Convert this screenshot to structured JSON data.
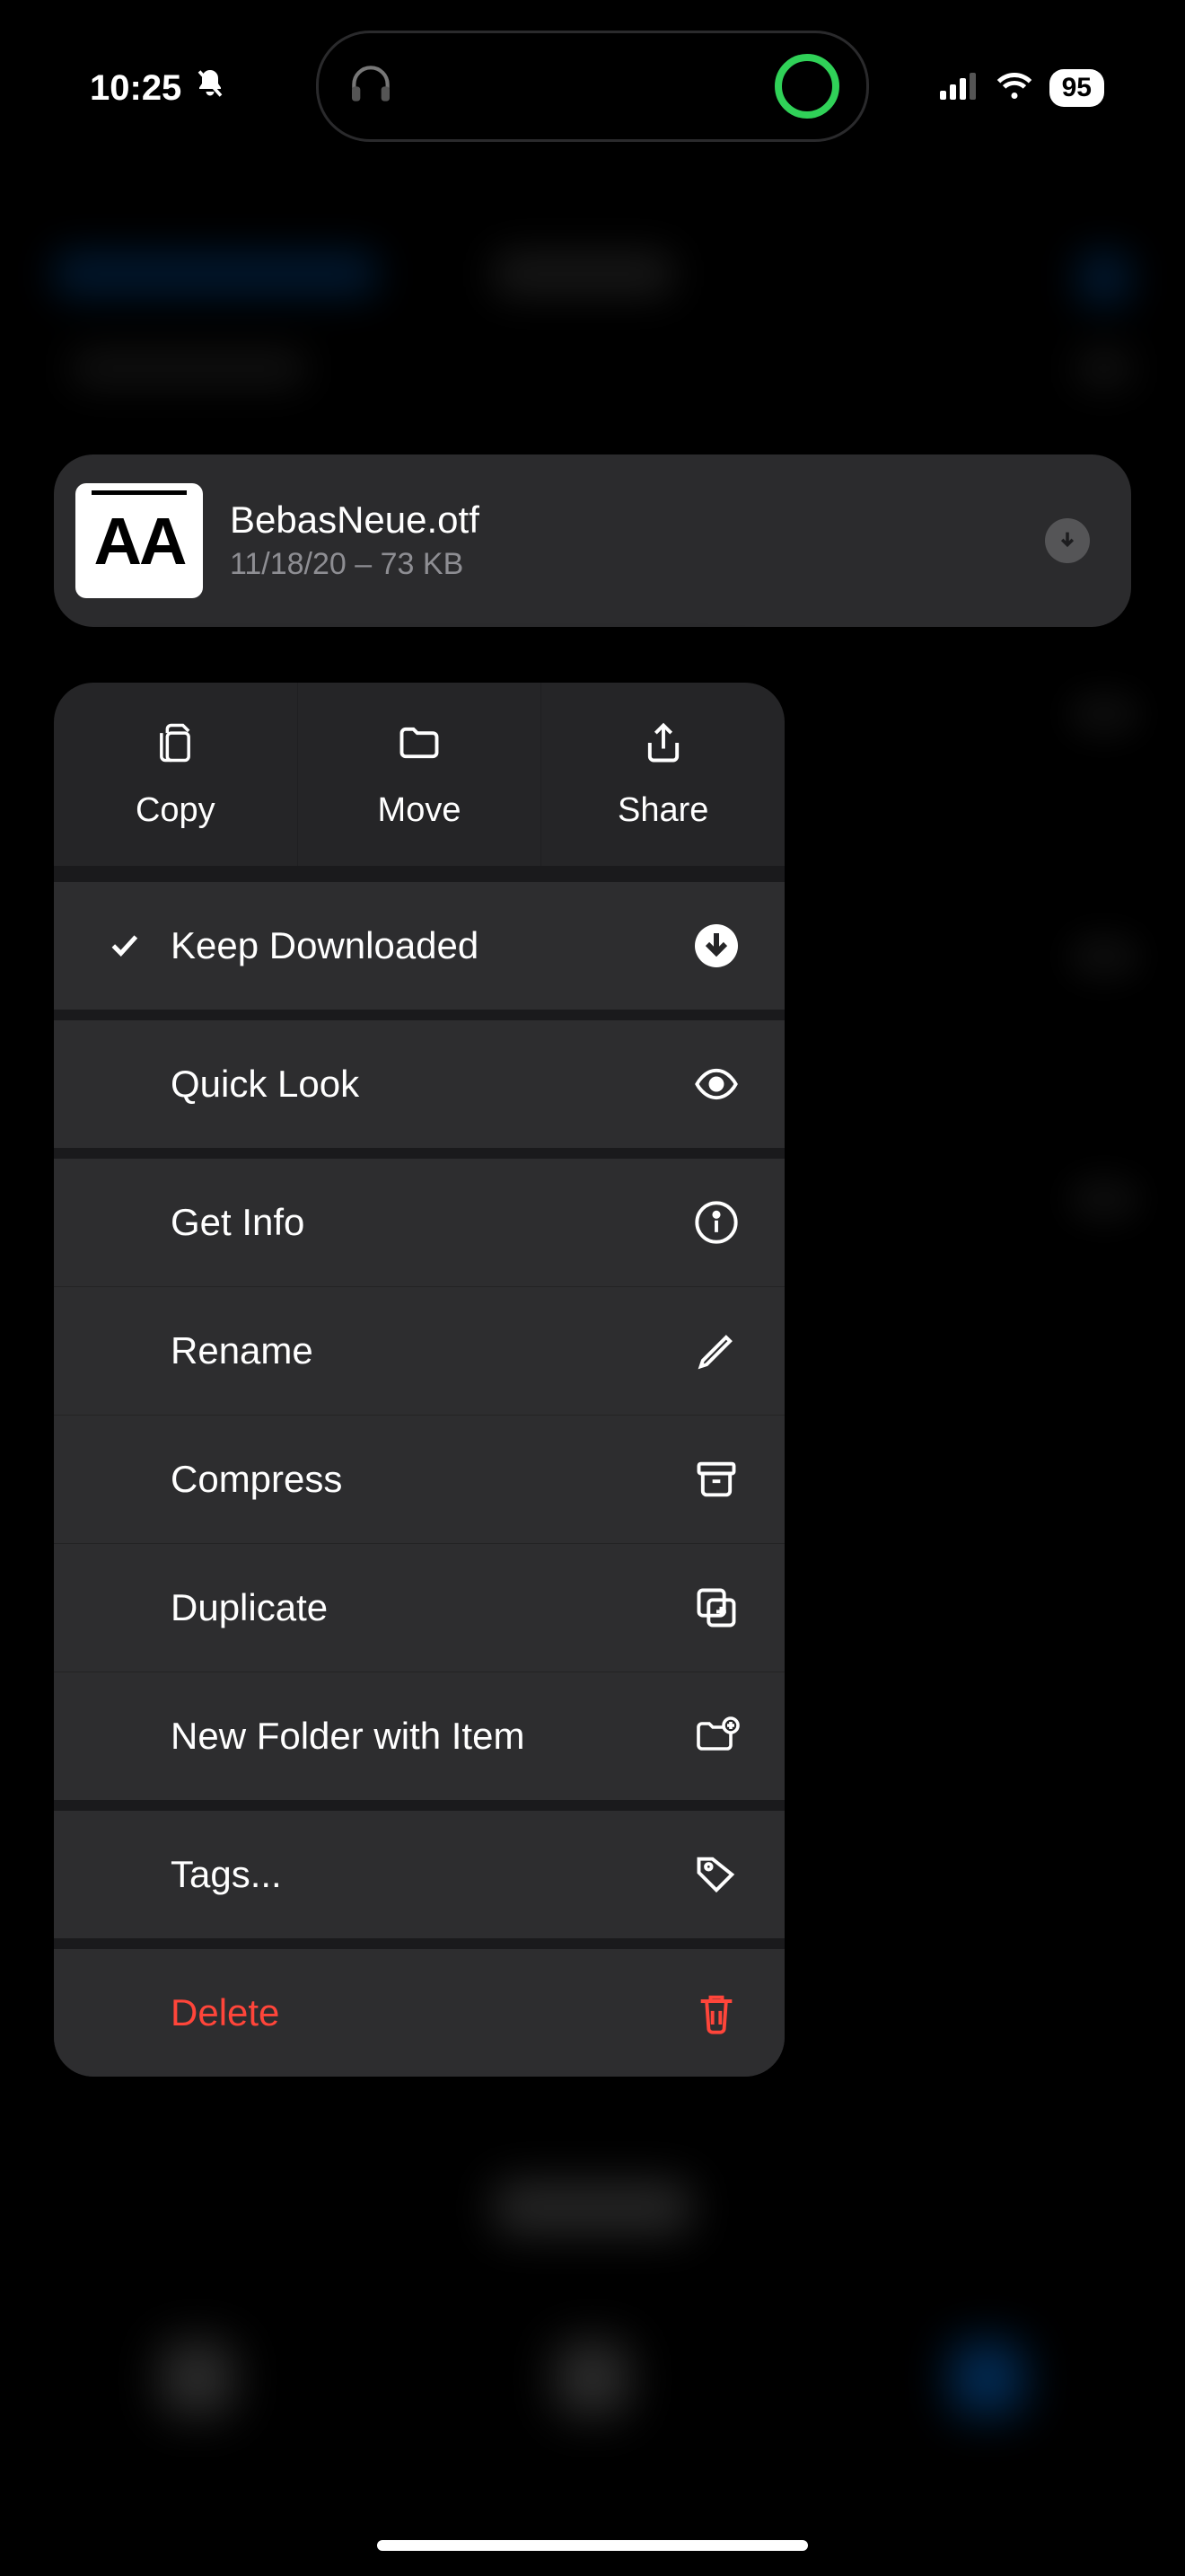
{
  "status": {
    "time": "10:25",
    "battery": "95"
  },
  "file": {
    "thumb_text": "AA",
    "name": "BebasNeue.otf",
    "date": "11/18/20",
    "sep": " – ",
    "size": "73 KB"
  },
  "top_actions": {
    "copy": "Copy",
    "move": "Move",
    "share": "Share"
  },
  "menu": {
    "keep_downloaded": "Keep Downloaded",
    "quick_look": "Quick Look",
    "get_info": "Get Info",
    "rename": "Rename",
    "compress": "Compress",
    "duplicate": "Duplicate",
    "new_folder": "New Folder with Item",
    "tags": "Tags...",
    "delete": "Delete"
  }
}
